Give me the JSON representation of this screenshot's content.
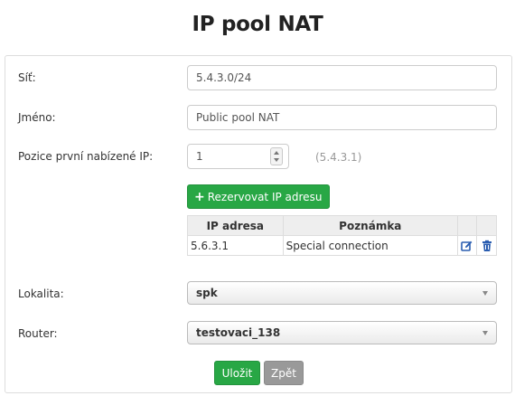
{
  "page": {
    "title": "IP pool NAT"
  },
  "form": {
    "network": {
      "label": "Síť:",
      "value": "5.4.3.0/24"
    },
    "name": {
      "label": "Jméno:",
      "value": "Public pool NAT"
    },
    "first_ip": {
      "label": "Pozice první nabízené IP:",
      "value": "1",
      "hint": "(5.4.3.1)"
    },
    "reserve_button": {
      "label": "Rezervovat IP adresu",
      "icon": "plus-icon"
    },
    "reserved_table": {
      "columns": [
        "IP adresa",
        "Poznámka"
      ],
      "rows": [
        {
          "ip": "5.6.3.1",
          "note": "Special connection"
        }
      ],
      "row_actions": [
        "edit-icon",
        "trash-icon"
      ]
    },
    "location": {
      "label": "Lokalita:",
      "value": "spk"
    },
    "router": {
      "label": "Router:",
      "value": "testovaci_138"
    },
    "save_label": "Uložit",
    "back_label": "Zpět"
  },
  "colors": {
    "primary_green": "#28a745",
    "secondary_gray": "#999999",
    "icon_blue": "#2a5db0"
  }
}
